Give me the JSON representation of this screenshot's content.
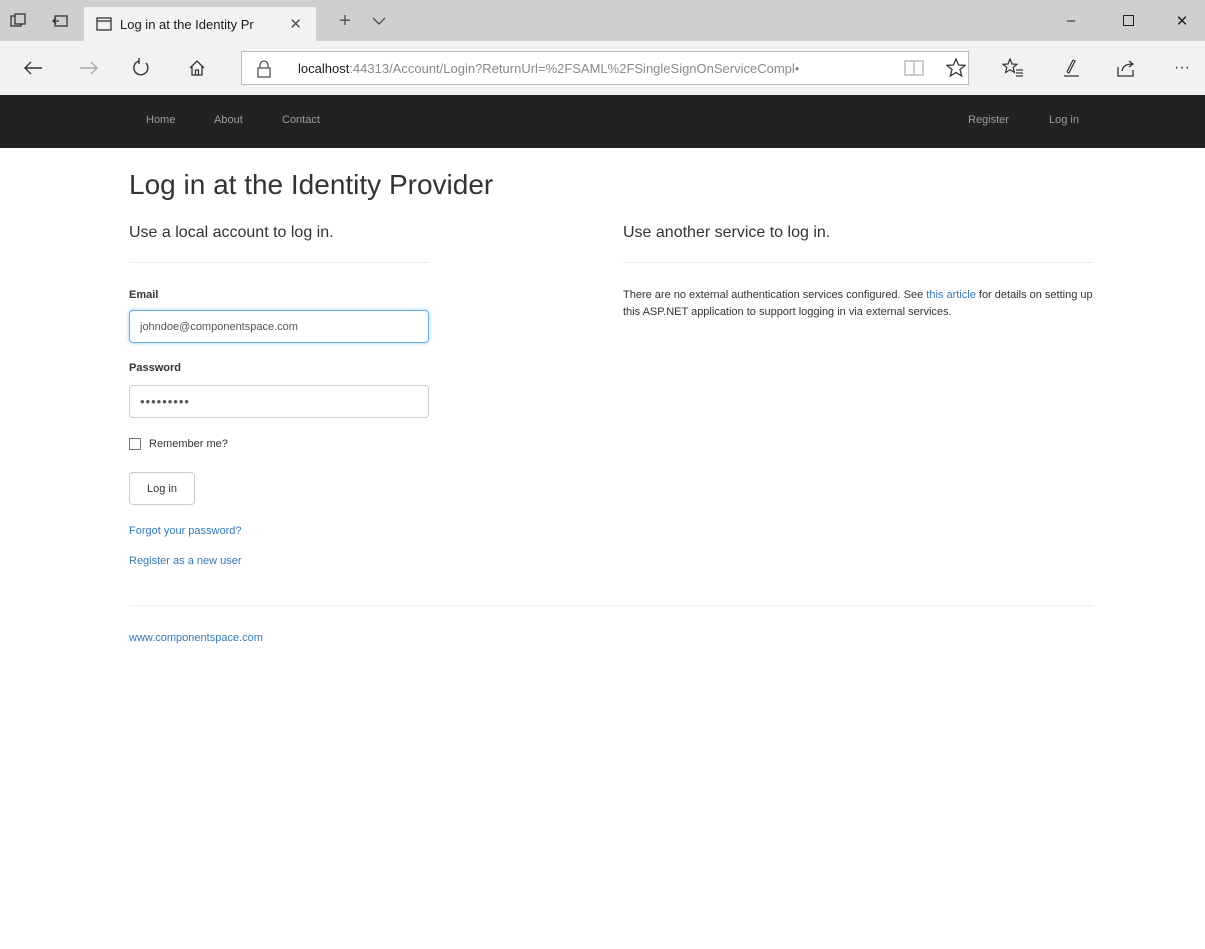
{
  "browser": {
    "tab_title": "Log in at the Identity Pr",
    "url_host": "localhost",
    "url_rest": ":44313/Account/Login?ReturnUrl=%2FSAML%2FSingleSignOnServiceCompl•"
  },
  "navbar": {
    "left": [
      "Home",
      "About",
      "Contact"
    ],
    "right": [
      "Register",
      "Log in"
    ]
  },
  "page": {
    "title": "Log in at the Identity Provider",
    "local_heading": "Use a local account to log in.",
    "external_heading": "Use another service to log in.",
    "email_label": "Email",
    "email_value": "johndoe@componentspace.com",
    "password_label": "Password",
    "password_value": "•••••••••",
    "remember_label": "Remember me?",
    "login_button": "Log in",
    "forgot_link": "Forgot your password?",
    "register_link": "Register as a new user",
    "external_text_before": "There are no external authentication services configured. See ",
    "external_link": "this article",
    "external_text_after": " for details on setting up this ASP.NET application to support logging in via external services.",
    "footer_link": "www.componentspace.com"
  },
  "colors": {
    "navbar_bg": "#222222",
    "link": "#337ab7",
    "titlebar_bg": "#cfcfcf"
  }
}
